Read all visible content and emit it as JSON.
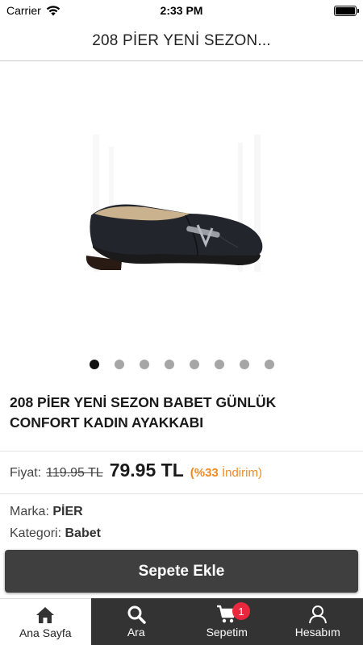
{
  "status_bar": {
    "carrier": "Carrier",
    "time": "2:33 PM"
  },
  "header": {
    "title": "208 PİER YENİ SEZON..."
  },
  "gallery": {
    "image_icon": "shoe-image",
    "slide_count": 8,
    "active_index": 0
  },
  "product": {
    "title": "208 PİER YENİ SEZON BABET GÜNLÜK CONFORT KADIN AYAKKABI",
    "price_label": "Fiyat:",
    "old_price": "119.95 TL",
    "new_price": "79.95 TL",
    "discount_percent": "(%33",
    "discount_label": "İndirim)",
    "brand_label": "Marka:",
    "brand": "PİER",
    "category_label": "Kategori:",
    "category": "Babet"
  },
  "actions": {
    "add_to_cart": "Sepete Ekle"
  },
  "tabbar": {
    "items": [
      {
        "label": "Ana Sayfa",
        "icon": "home-icon"
      },
      {
        "label": "Ara",
        "icon": "search-icon"
      },
      {
        "label": "Sepetim",
        "icon": "cart-icon"
      },
      {
        "label": "Hesabım",
        "icon": "user-icon"
      }
    ],
    "cart_badge": "1"
  },
  "colors": {
    "accent": "#f08a1e",
    "badge": "#e8283c",
    "tab_bg": "#333333",
    "button_bg": "#3f3f3f"
  }
}
